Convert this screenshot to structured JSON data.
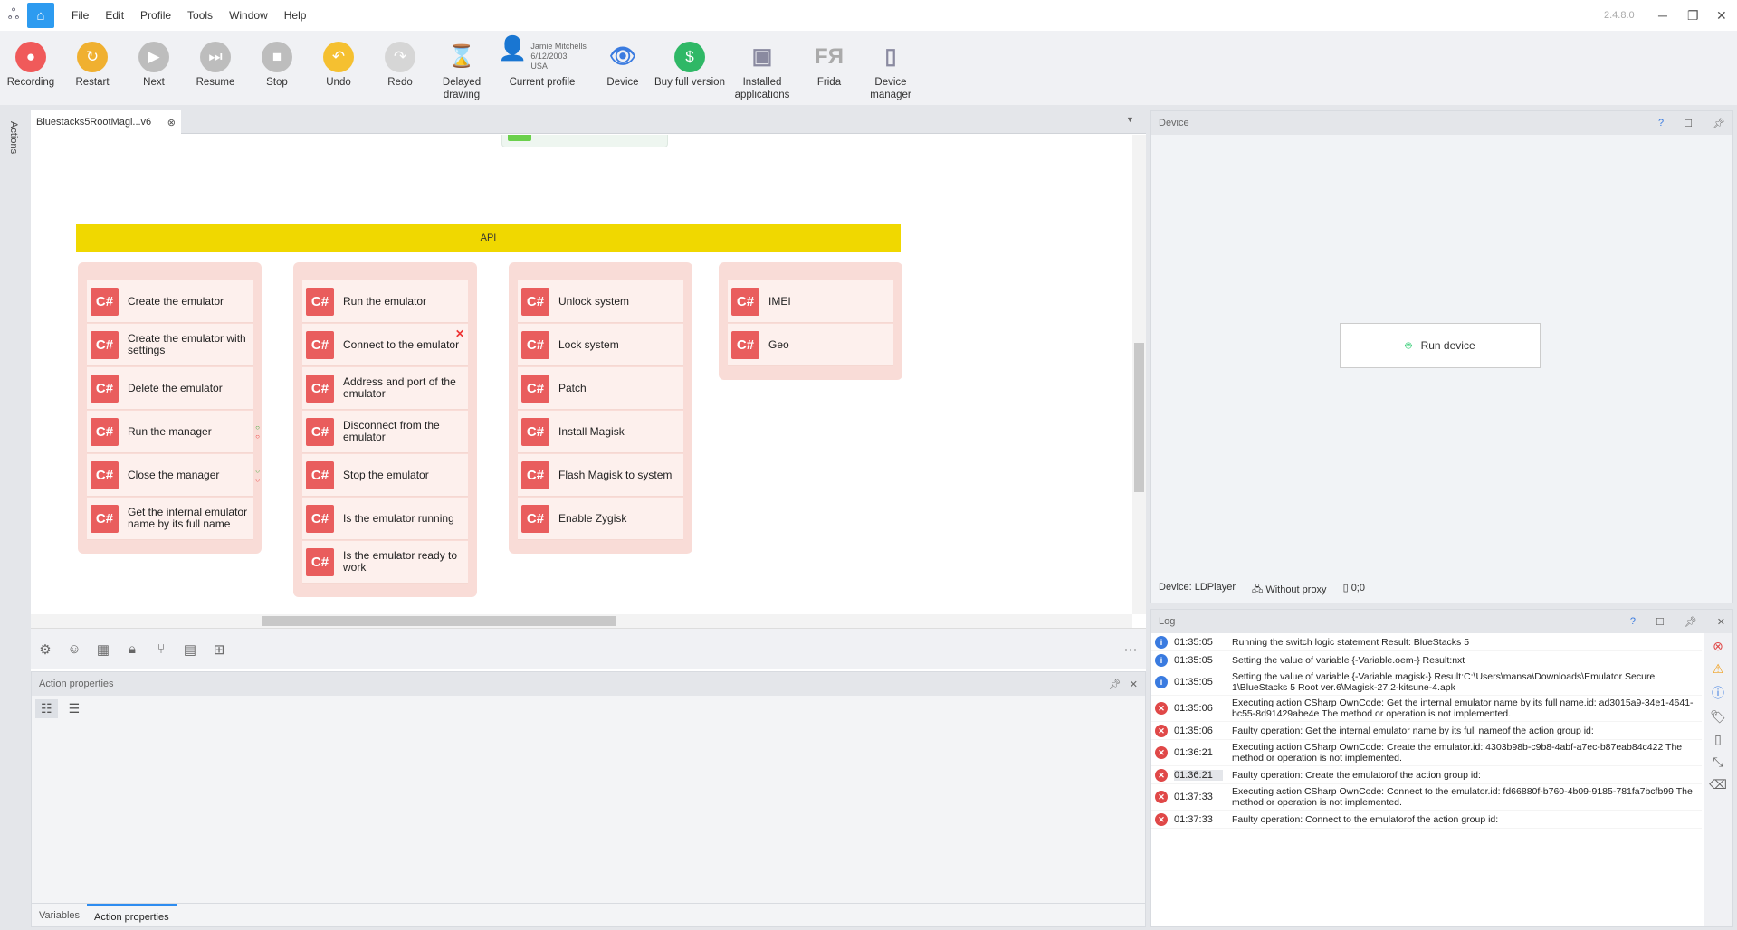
{
  "app": {
    "version": "2.4.8.0"
  },
  "menu": [
    "File",
    "Edit",
    "Profile",
    "Tools",
    "Window",
    "Help"
  ],
  "toolbar": [
    {
      "label": "Recording",
      "icon": "record-icon",
      "color": "#f05a5a",
      "glyph": "●"
    },
    {
      "label": "Restart",
      "icon": "restart-icon",
      "color": "#f0b030",
      "glyph": "↻"
    },
    {
      "label": "Next",
      "icon": "next-icon",
      "color": "#bdbdbd",
      "glyph": "▶"
    },
    {
      "label": "Resume",
      "icon": "resume-icon",
      "color": "#bdbdbd",
      "glyph": "⏭"
    },
    {
      "label": "Stop",
      "icon": "stop-icon",
      "color": "#bdbdbd",
      "glyph": "■"
    },
    {
      "label": "Undo",
      "icon": "undo-icon",
      "color": "#f5c030",
      "glyph": "↶"
    },
    {
      "label": "Redo",
      "icon": "redo-icon",
      "color": "#d6d6d6",
      "glyph": "↷"
    },
    {
      "label": "Delayed drawing",
      "icon": "hourglass-icon",
      "color": "transparent",
      "glyph": "⌛"
    },
    {
      "label": "Current profile",
      "icon": "profile-avatar-icon",
      "color": "transparent",
      "glyph": "👤"
    },
    {
      "label": "Device",
      "icon": "eye-icon",
      "color": "transparent",
      "glyph": "👁"
    },
    {
      "label": "Buy full version",
      "icon": "dollar-icon",
      "color": "#2fb866",
      "glyph": "$"
    },
    {
      "label": "Installed applications",
      "icon": "apps-icon",
      "color": "transparent",
      "glyph": "▣"
    },
    {
      "label": "Frida",
      "icon": "frida-icon",
      "color": "transparent",
      "glyph": "FЯ"
    },
    {
      "label": "Device manager",
      "icon": "device-manager-icon",
      "color": "transparent",
      "glyph": "▯"
    }
  ],
  "profile": {
    "name": "Jamie Mitchells",
    "dob": "6/12/2003",
    "country": "USA"
  },
  "sidebar": {
    "actions_label": "Actions"
  },
  "editor": {
    "tab_label": "Bluestacks5RootMagi...v6",
    "api_label": "API",
    "groups": [
      [
        "Create the emulator",
        "Create the emulator with settings",
        "Delete the emulator",
        "Run the manager",
        "Close the manager",
        "Get the internal emulator name by its full name"
      ],
      [
        "Run the emulator",
        "Connect to the emulator",
        "Address and port of the emulator",
        "Disconnect from the emulator",
        "Stop the emulator",
        "Is the emulator running",
        "Is the emulator ready to work"
      ],
      [
        "Unlock system",
        "Lock system",
        "Patch",
        "Install Magisk",
        "Flash Magisk to system",
        "Enable Zygisk"
      ],
      [
        "IMEI",
        "Geo"
      ]
    ],
    "badge": "C#"
  },
  "action_properties": {
    "title": "Action properties",
    "tabs": [
      "Variables",
      "Action properties"
    ],
    "active_tab": "Action properties"
  },
  "device": {
    "title": "Device",
    "run_button": "Run device",
    "device_label": "Device: LDPlayer",
    "proxy": "Without proxy",
    "coords": "0;0"
  },
  "log": {
    "title": "Log",
    "entries": [
      {
        "type": "info",
        "time": "01:35:05",
        "msg": "Running the switch logic statement  Result: BlueStacks 5"
      },
      {
        "type": "info",
        "time": "01:35:05",
        "msg": "Setting the value of variable {-Variable.oem-}  Result:nxt"
      },
      {
        "type": "info",
        "time": "01:35:05",
        "msg": "Setting the value of variable {-Variable.magisk-}  Result:C:\\Users\\mansa\\Downloads\\Emulator Secure 1\\BlueStacks 5 Root ver.6\\Magisk-27.2-kitsune-4.apk"
      },
      {
        "type": "error",
        "time": "01:35:06",
        "msg": "Executing action CSharp OwnCode: Get the internal emulator name by its full name.id: ad3015a9-34e1-4641-bc55-8d91429abe4e  The method or operation is not implemented."
      },
      {
        "type": "error",
        "time": "01:35:06",
        "msg": "Faulty operation: Get the internal emulator name by its full nameof the action group id:"
      },
      {
        "type": "error",
        "time": "01:36:21",
        "msg": "Executing action CSharp OwnCode: Create the emulator.id: 4303b98b-c9b8-4abf-a7ec-b87eab84c422  The method or operation is not implemented."
      },
      {
        "type": "error",
        "time": "01:36:21",
        "msg": "Faulty operation: Create the emulatorof the action group id:"
      },
      {
        "type": "error",
        "time": "01:37:33",
        "msg": "Executing action CSharp OwnCode: Connect to the emulator.id: fd66880f-b760-4b09-9185-781fa7bcfb99  The method or operation is not implemented."
      },
      {
        "type": "error",
        "time": "01:37:33",
        "msg": "Faulty operation: Connect to the emulatorof the action group id:"
      }
    ]
  }
}
